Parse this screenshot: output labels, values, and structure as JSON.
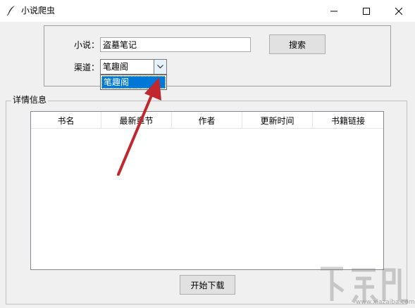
{
  "window": {
    "title": "小说爬虫",
    "app_icon": "feather-icon",
    "controls": {
      "minimize": "minimize-icon",
      "maximize": "maximize-icon",
      "close": "close-icon"
    }
  },
  "search_form": {
    "novel_label": "小说：",
    "novel_value": "盗墓笔记",
    "search_label": "搜索",
    "channel_label": "渠道：",
    "channel_value": "笔趣阁",
    "dropdown_options": [
      "笔趣阁"
    ]
  },
  "details": {
    "legend": "详情信息",
    "columns": [
      "书名",
      "最新章节",
      "作者",
      "更新时间",
      "书籍链接"
    ],
    "rows": []
  },
  "download_label": "开始下载",
  "watermark": {
    "url": "www.xiazaiba.com"
  },
  "colors": {
    "selection": "#0078d7",
    "arrow": "#c0282d",
    "button_bg": "#e1e1e1",
    "window_bg": "#f0f0f0"
  }
}
